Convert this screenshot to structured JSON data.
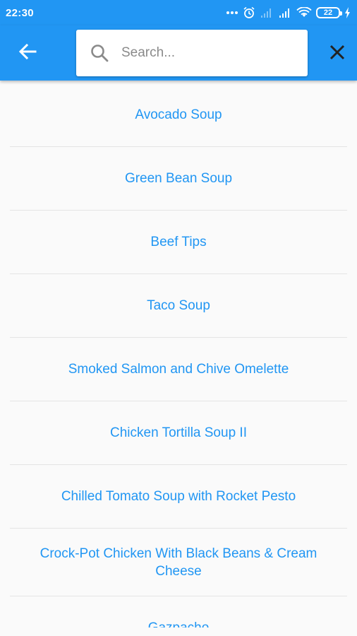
{
  "status_bar": {
    "time": "22:30",
    "battery": "22",
    "icons": [
      "dots-icon",
      "alarm-icon",
      "signal-icon",
      "signal-icon",
      "wifi-icon",
      "battery-icon",
      "charging-icon"
    ]
  },
  "app_bar": {
    "back_icon": "arrow-left-icon",
    "search": {
      "placeholder": "Search...",
      "value": ""
    },
    "close_icon": "close-icon",
    "color": "#2196f3"
  },
  "results": [
    {
      "label": "Avocado Soup"
    },
    {
      "label": "Green Bean Soup"
    },
    {
      "label": "Beef Tips"
    },
    {
      "label": "Taco Soup"
    },
    {
      "label": "Smoked Salmon and Chive Omelette"
    },
    {
      "label": "Chicken Tortilla Soup II"
    },
    {
      "label": "Chilled Tomato Soup with Rocket Pesto"
    },
    {
      "label": "Crock-Pot Chicken With Black Beans & Cream Cheese"
    },
    {
      "label": "Gazpacho"
    }
  ],
  "colors": {
    "accent": "#2196f3",
    "text_link": "#2196f3",
    "divider": "#e4e4e4"
  }
}
